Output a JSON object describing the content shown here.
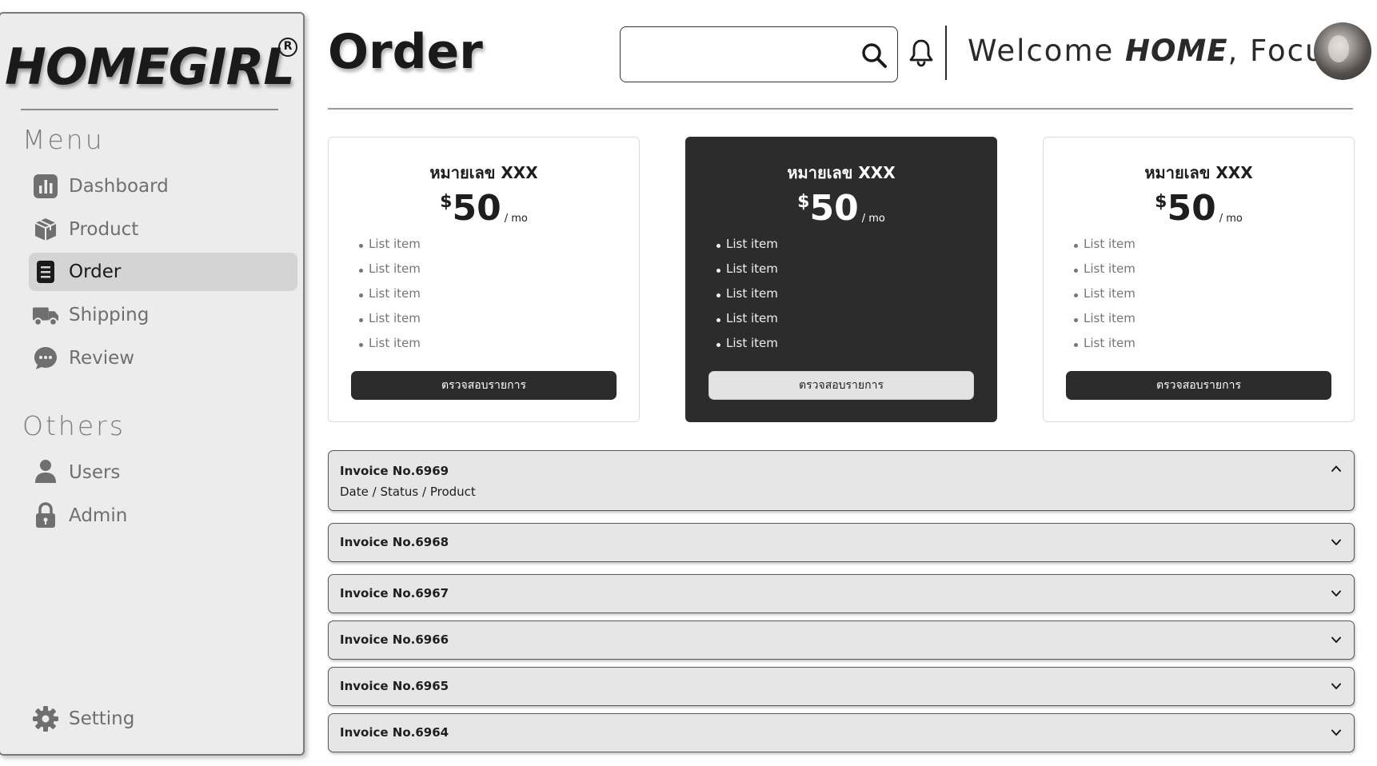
{
  "brand": {
    "logo_text": "HOMEGIRL",
    "registered_mark": "R"
  },
  "sidebar": {
    "menu_title": "Menu",
    "menu_items": [
      {
        "label": "Dashboard",
        "icon": "bar-chart-icon",
        "active": false
      },
      {
        "label": "Product",
        "icon": "box-icon",
        "active": false
      },
      {
        "label": "Order",
        "icon": "document-icon",
        "active": true
      },
      {
        "label": "Shipping",
        "icon": "truck-icon",
        "active": false
      },
      {
        "label": "Review",
        "icon": "chat-bubble-icon",
        "active": false
      }
    ],
    "others_title": "Others",
    "others_items": [
      {
        "label": "Users",
        "icon": "user-icon"
      },
      {
        "label": "Admin",
        "icon": "lock-icon"
      }
    ],
    "setting_label": "Setting"
  },
  "header": {
    "title": "Order",
    "search": {
      "value": "",
      "placeholder": ""
    },
    "welcome_prefix": "Welcome ",
    "welcome_brand": "HOME",
    "welcome_suffix": ", Focus"
  },
  "pricing_cards": [
    {
      "title": "หมายเลข XXX",
      "currency": "$",
      "amount": "50",
      "period": "/ mo",
      "items": [
        "List item",
        "List item",
        "List item",
        "List item",
        "List item"
      ],
      "button_label": "ตรวจสอบรายการ",
      "style": "light"
    },
    {
      "title": "หมายเลข XXX",
      "currency": "$",
      "amount": "50",
      "period": "/ mo",
      "items": [
        "List item",
        "List item",
        "List item",
        "List item",
        "List item"
      ],
      "button_label": "ตรวจสอบรายการ",
      "style": "dark"
    },
    {
      "title": "หมายเลข XXX",
      "currency": "$",
      "amount": "50",
      "period": "/ mo",
      "items": [
        "List item",
        "List item",
        "List item",
        "List item",
        "List item"
      ],
      "button_label": "ตรวจสอบรายการ",
      "style": "light"
    }
  ],
  "invoices": [
    {
      "title": "Invoice No.6969",
      "detail": "Date / Status / Product",
      "expanded": true
    },
    {
      "title": "Invoice No.6968",
      "expanded": false
    },
    {
      "title": "Invoice No.6967",
      "expanded": false
    },
    {
      "title": "Invoice No.6966",
      "expanded": false
    },
    {
      "title": "Invoice No.6965",
      "expanded": false
    },
    {
      "title": "Invoice No.6964",
      "expanded": false
    }
  ],
  "colors": {
    "sidebar_bg": "#ececec",
    "active_item_bg": "#d4d4d4",
    "dark_card": "#2c2c2c",
    "invoice_bg": "#e6e6e6",
    "muted_text": "#7d7d7d"
  }
}
